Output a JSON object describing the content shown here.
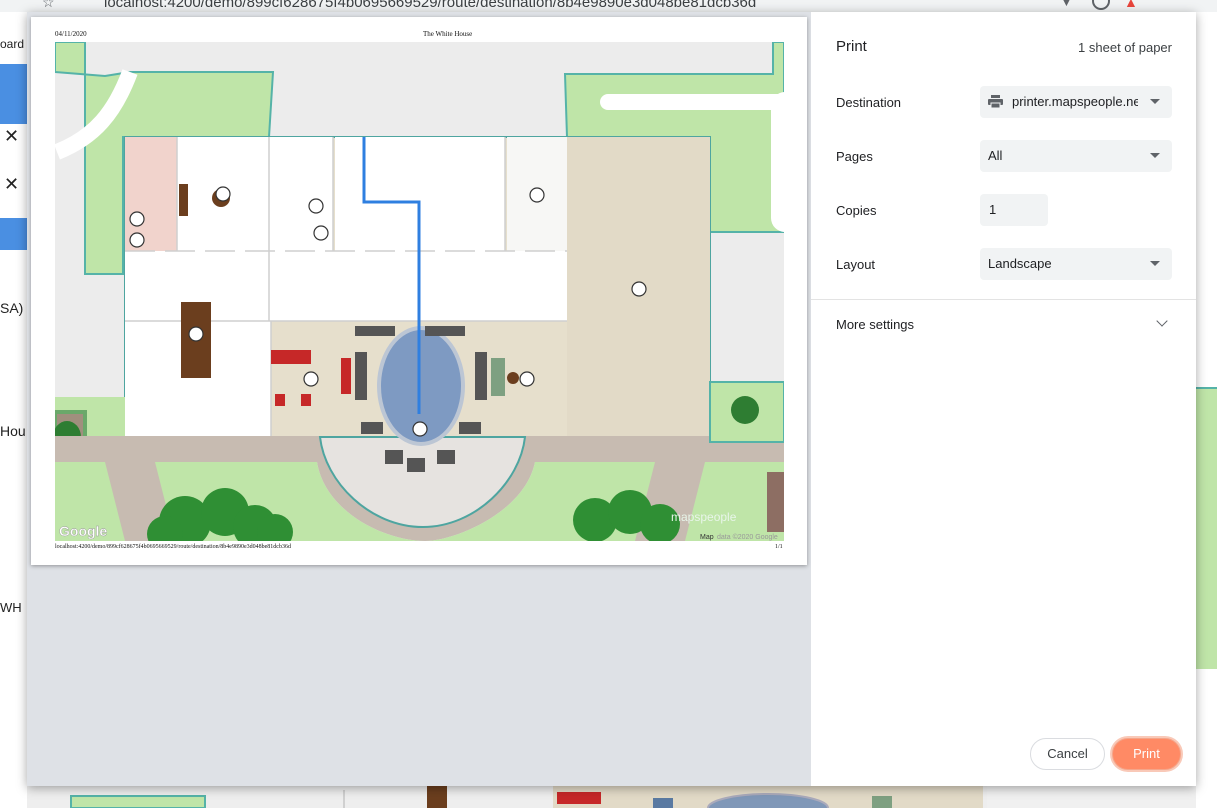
{
  "browser": {
    "url": "localhost:4200/demo/899cf628675f4b0695669529/route/destination/8b4e9890e3d048be81dcb36d"
  },
  "background_page": {
    "left_fragments": [
      "oard",
      "SA)",
      "Hou",
      "WH"
    ]
  },
  "preview": {
    "date": "04/11/2020",
    "title": "The White House",
    "url": "localhost:4200/demo/899cf628675f4b0695669529/route/destination/8b4e9890e3d048be81dcb36d",
    "page_number": "1/1",
    "map_brand_google": "Google",
    "map_brand_mapspeople": "mapspeople",
    "map_attribution_prefix": "Map ",
    "map_attribution": "data ©2020 Google"
  },
  "print_settings": {
    "title": "Print",
    "sheet_count": "1 sheet of paper",
    "destination": {
      "label": "Destination",
      "value": "printer.mapspeople.net",
      "icon": "printer-icon"
    },
    "pages": {
      "label": "Pages",
      "value": "All"
    },
    "copies": {
      "label": "Copies",
      "value": "1"
    },
    "layout": {
      "label": "Layout",
      "value": "Landscape"
    },
    "more_settings": "More settings",
    "cancel_label": "Cancel",
    "print_label": "Print",
    "accent_color": "#ff8a65"
  }
}
